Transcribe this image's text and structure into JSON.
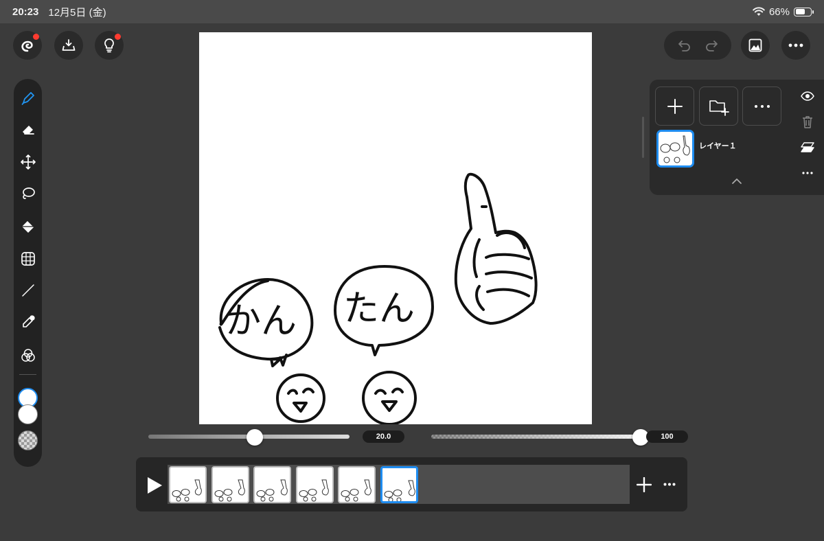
{
  "status_bar": {
    "time": "20:23",
    "date": "12月5日 (金)",
    "battery": "66%",
    "battery_level": 0.66
  },
  "top_left": {
    "buttons": [
      {
        "name": "app-logo-button",
        "icon": "swirl-logo-icon",
        "badge": true
      },
      {
        "name": "import-button",
        "icon": "tray-download-icon",
        "badge": false
      },
      {
        "name": "tips-button",
        "icon": "lightbulb-icon",
        "badge": true
      }
    ]
  },
  "top_right": {
    "buttons": [
      "undo-icon",
      "redo-icon",
      "gallery-icon",
      "more-icon"
    ]
  },
  "toolbar": {
    "tools": [
      "pen-icon",
      "eraser-icon",
      "move-icon",
      "lasso-icon",
      "fill-bucket-icon",
      "transform-grid-icon",
      "line-icon",
      "eyedropper-icon",
      "color-blend-icon"
    ],
    "active_tool": "pen-icon",
    "colors": {
      "primary": "#ffffff",
      "secondary": "#ffffff",
      "accent": "#1e8cf0"
    }
  },
  "canvas": {
    "bubble_left_text": "かん",
    "bubble_right_text": "たん"
  },
  "brush": {
    "size_label": "20.0",
    "size_fraction": 0.53,
    "opacity_label": "100",
    "opacity_fraction": 1.0
  },
  "layers": {
    "buttons": [
      "add-layer-icon",
      "add-folder-icon",
      "layer-more-icon"
    ],
    "items": [
      {
        "name": "レイヤー１",
        "selected": true
      }
    ],
    "side_icons": [
      "eye-icon",
      "trash-icon",
      "merge-layers-icon",
      "more-icon"
    ]
  },
  "timeline": {
    "frame_count": 6,
    "active_frame": 6
  }
}
